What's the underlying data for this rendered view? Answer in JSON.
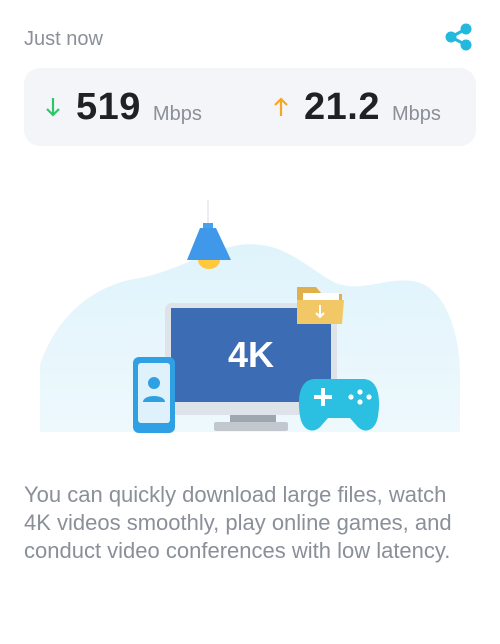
{
  "header": {
    "timestamp": "Just now",
    "share_icon": "share-icon"
  },
  "speed": {
    "download": {
      "icon": "arrow-down-icon",
      "value": "519",
      "unit": "Mbps",
      "color": "#2cc76a"
    },
    "upload": {
      "icon": "arrow-up-icon",
      "value": "21.2",
      "unit": "Mbps",
      "color": "#f5a623"
    }
  },
  "illustration": {
    "screen_label": "4K",
    "accent_color": "#23b8de"
  },
  "description": "You can quickly download large files, watch 4K videos smoothly, play online games, and conduct video conferences with low latency."
}
